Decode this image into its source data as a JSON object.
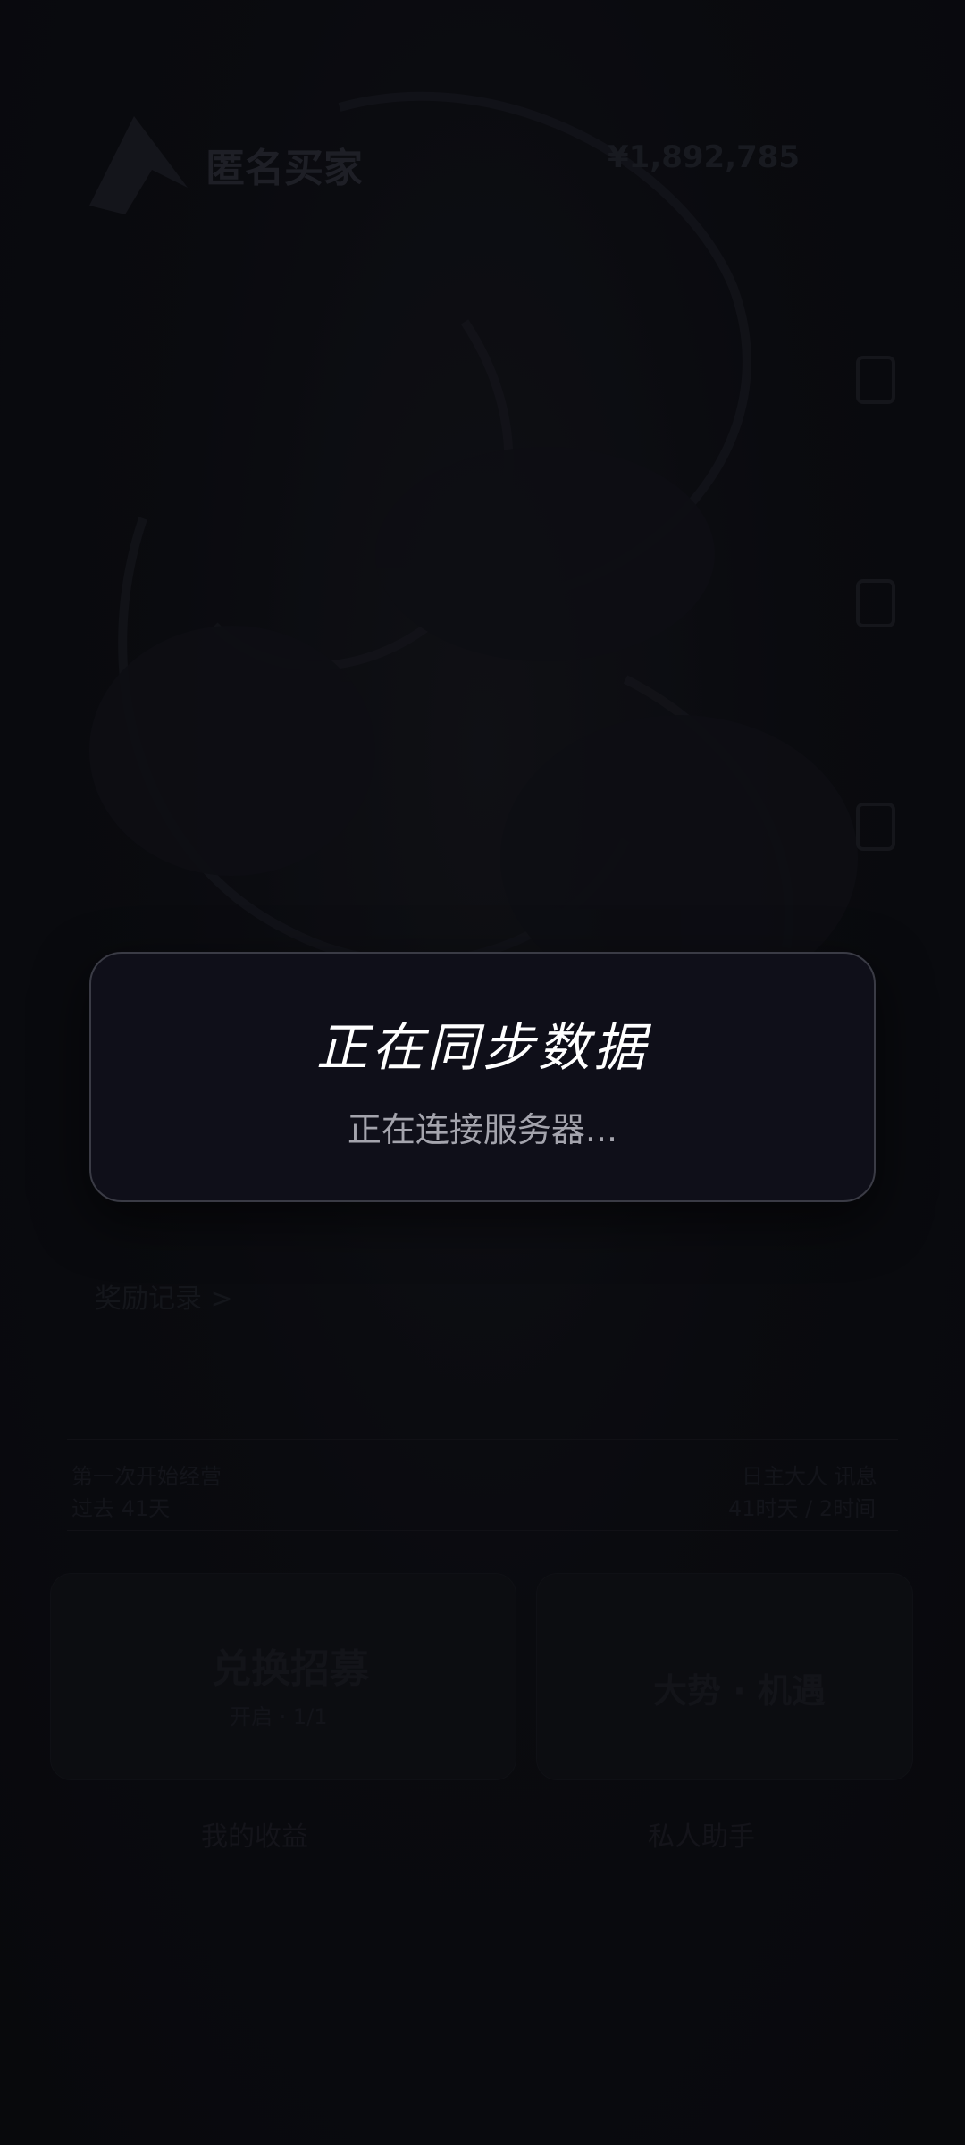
{
  "background_app": {
    "title": "匿名买家",
    "balance": "¥1,892,785",
    "section_label": "奖励记录 >",
    "row_left_primary": "第一次开始经营",
    "row_left_secondary": "过去 41天",
    "row_right_primary": "日主大人 讯息",
    "row_right_secondary": "41时天 / 2时间",
    "card_left_text": "兑换招募",
    "card_left_sub": "开启 · 1/1",
    "card_right_text": "大势 · 机遇",
    "tab_left": "我的收益",
    "tab_right": "私人助手"
  },
  "dialog": {
    "title": "正在同步数据",
    "subtitle": "正在连接服务器..."
  },
  "colors": {
    "background": "#0b0c10",
    "dialog_bg": "#0f0f19",
    "dialog_border": "#3a3b45",
    "title_text": "#ffffff",
    "subtitle_text": "#a4a4ad"
  }
}
